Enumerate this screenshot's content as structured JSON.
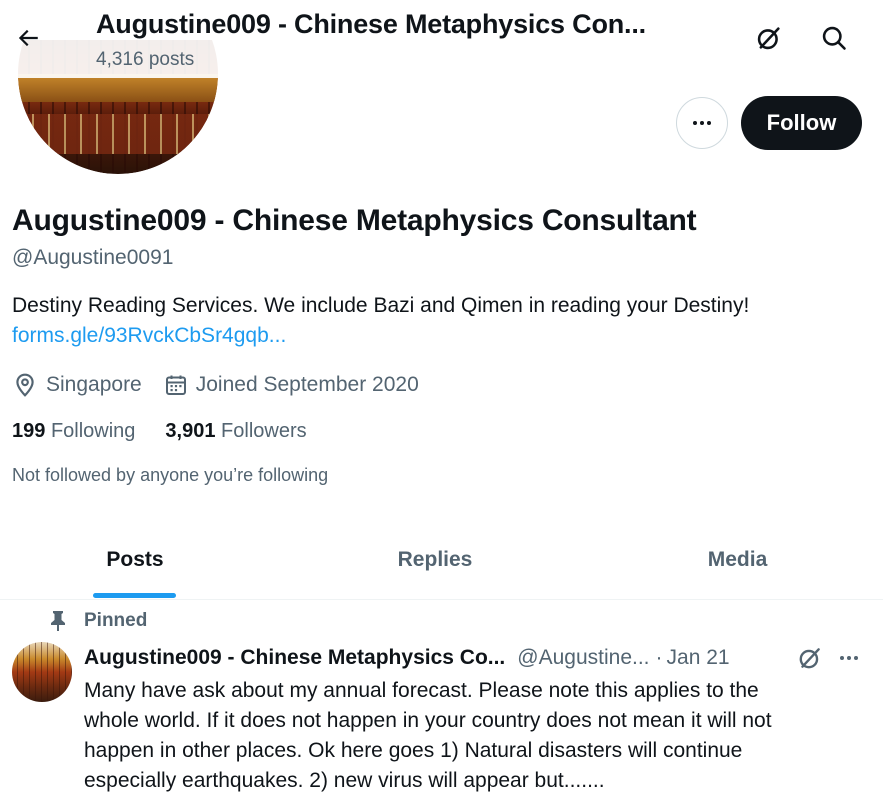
{
  "header": {
    "title": "Augustine009 - Chinese Metaphysics Con...",
    "post_count": "4,316 posts"
  },
  "profile": {
    "display_name": "Augustine009 - Chinese Metaphysics Consultant",
    "handle": "@Augustine0091",
    "bio": "Destiny Reading Services. We include Bazi and Qimen in reading your Destiny!",
    "link": "forms.gle/93RvckCbSr4gqb...",
    "location": "Singapore",
    "joined": "Joined September 2020",
    "following_count": "199",
    "following_label": "Following",
    "followers_count": "3,901",
    "followers_label": "Followers",
    "not_followed_note": "Not followed by anyone you’re following",
    "follow_button": "Follow"
  },
  "tabs": [
    {
      "label": "Posts",
      "active": true
    },
    {
      "label": "Replies",
      "active": false
    },
    {
      "label": "Media",
      "active": false
    }
  ],
  "pinned_post": {
    "pinned_label": "Pinned",
    "author_name": "Augustine009 - Chinese Metaphysics Co...",
    "author_handle": "@Augustine...",
    "separator": "·",
    "date": "Jan 21",
    "text_lines": [
      "Many have ask about my annual forecast. Please note this applies to the",
      "whole world. If it does not happen in your country does not mean it will not",
      "happen in other places. Ok here goes 1) Natural disasters will continue",
      "especially earthquakes. 2) new virus will appear but......."
    ]
  },
  "icons": {
    "back": "back-arrow-icon",
    "grok": "grok-icon",
    "search": "search-icon",
    "more": "more-horizontal-icon",
    "location": "location-pin-icon",
    "calendar": "calendar-icon",
    "pin": "pin-icon"
  },
  "colors": {
    "text_primary": "#0f1419",
    "text_secondary": "#536471",
    "accent": "#1d9bf0",
    "border": "#cfd9de"
  }
}
